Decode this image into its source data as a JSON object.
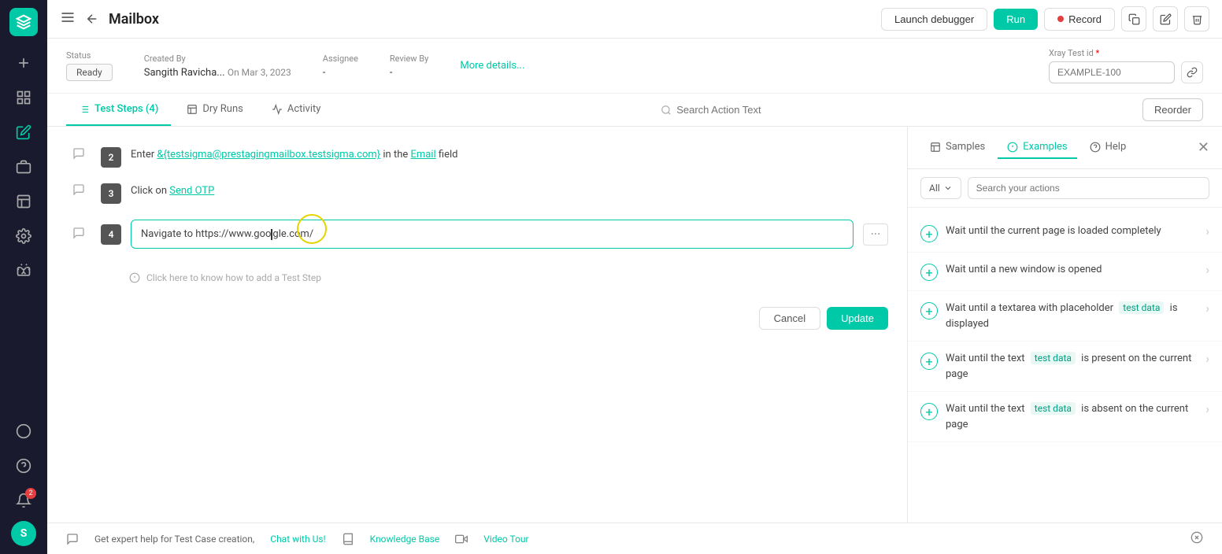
{
  "app": {
    "logo_letter": "✦",
    "title": "Mailbox"
  },
  "sidebar": {
    "items": [
      {
        "id": "add",
        "icon": "plus",
        "label": "Add"
      },
      {
        "id": "dashboard",
        "icon": "chart",
        "label": "Dashboard"
      },
      {
        "id": "edit",
        "icon": "pencil",
        "label": "Edit",
        "active": true
      },
      {
        "id": "briefcase",
        "icon": "briefcase",
        "label": "Projects"
      },
      {
        "id": "grid",
        "icon": "grid",
        "label": "Grid"
      },
      {
        "id": "settings",
        "icon": "gear",
        "label": "Settings"
      },
      {
        "id": "bug",
        "icon": "bug",
        "label": "Bug"
      },
      {
        "id": "circle",
        "icon": "circle",
        "label": "Circle"
      },
      {
        "id": "help",
        "icon": "help",
        "label": "Help"
      },
      {
        "id": "notifications",
        "icon": "bell",
        "label": "Notifications",
        "badge": "2"
      }
    ],
    "avatar_letter": "S"
  },
  "topbar": {
    "title": "Mailbox",
    "buttons": {
      "debugger": "Launch debugger",
      "run": "Run",
      "record": "Record"
    }
  },
  "meta": {
    "status_label": "Status",
    "status_value": "Ready",
    "created_by_label": "Created By",
    "created_by_value": "Sangith Ravicha...",
    "created_date": "On Mar 3, 2023",
    "assignee_label": "Assignee",
    "assignee_value": "-",
    "review_by_label": "Review By",
    "review_by_value": "-",
    "more_details": "More details...",
    "xray_label": "Xray Test id",
    "xray_placeholder": "EXAMPLE-100"
  },
  "tabs": {
    "items": [
      {
        "id": "test-steps",
        "label": "Test Steps (4)",
        "active": true
      },
      {
        "id": "dry-runs",
        "label": "Dry Runs"
      },
      {
        "id": "activity",
        "label": "Activity"
      },
      {
        "id": "search",
        "label": "Search Action Text",
        "is_search": true
      }
    ],
    "reorder": "Reorder"
  },
  "steps": [
    {
      "number": "2",
      "type": "text",
      "content": "Enter",
      "link": "&{testsigma@prestagingmailbox.testsigma.com}",
      "middle": "in the",
      "field_link": "Email",
      "suffix": "field"
    },
    {
      "number": "3",
      "type": "text",
      "content": "Click on",
      "link": "Send OTP"
    },
    {
      "number": "4",
      "type": "editing",
      "content": "Navigate to https://www.google.com/"
    }
  ],
  "step_edit": {
    "cancel": "Cancel",
    "update": "Update",
    "hint": "Click here to know how to add a Test Step"
  },
  "right_panel": {
    "tabs": [
      {
        "id": "samples",
        "label": "Samples"
      },
      {
        "id": "examples",
        "label": "Examples",
        "active": true
      },
      {
        "id": "help",
        "label": "Help"
      }
    ],
    "filter_label": "All",
    "search_placeholder": "Search your actions",
    "actions": [
      {
        "id": "wait-page-loaded",
        "text": "Wait until the current page is loaded completely"
      },
      {
        "id": "wait-new-window",
        "text": "Wait until a new window is opened"
      },
      {
        "id": "wait-textarea",
        "text_before": "Wait until a textarea with placeholder",
        "highlight": "test data",
        "text_after": "is displayed"
      },
      {
        "id": "wait-text-present",
        "text_before": "Wait until the text",
        "highlight": "test data",
        "text_after": "is present on the current page"
      },
      {
        "id": "wait-text-absent",
        "text_before": "Wait until the text",
        "highlight": "test data",
        "text_after": "is absent on the current page"
      }
    ]
  },
  "bottom_bar": {
    "help_text": "Get expert help for Test Case creation,",
    "chat_link": "Chat with Us!",
    "knowledge_base": "Knowledge Base",
    "video_tour": "Video Tour"
  }
}
